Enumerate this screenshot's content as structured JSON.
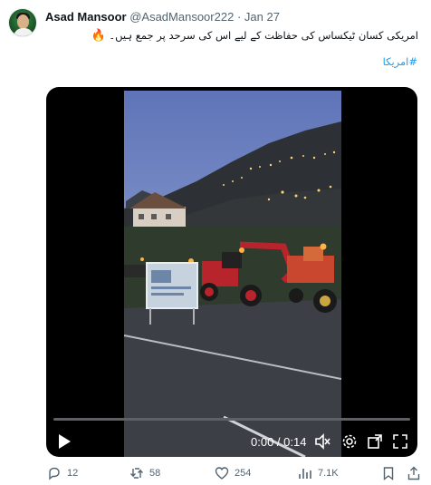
{
  "author": {
    "display_name": "Asad Mansoor",
    "handle": "@AsadMansoor222",
    "separator": "·",
    "date": "Jan 27"
  },
  "tweet": {
    "text": "امریکی کسان ٹیکساس کی حفاظت کے لیے اس کی سرحد پر جمع ہیں۔",
    "emoji": "🔥",
    "hashtag": "#امریکا"
  },
  "video": {
    "time_display": "0:00 / 0:14",
    "progress": 0,
    "icons": [
      "play-icon",
      "volume-icon",
      "settings-icon",
      "exit-fullscreen-icon",
      "fullscreen-icon"
    ]
  },
  "actions": {
    "replies": "12",
    "reposts": "58",
    "likes": "254",
    "views": "7.1K"
  },
  "colors": {
    "link": "#1d9bf0",
    "muted": "#536471",
    "text": "#0f1419"
  }
}
